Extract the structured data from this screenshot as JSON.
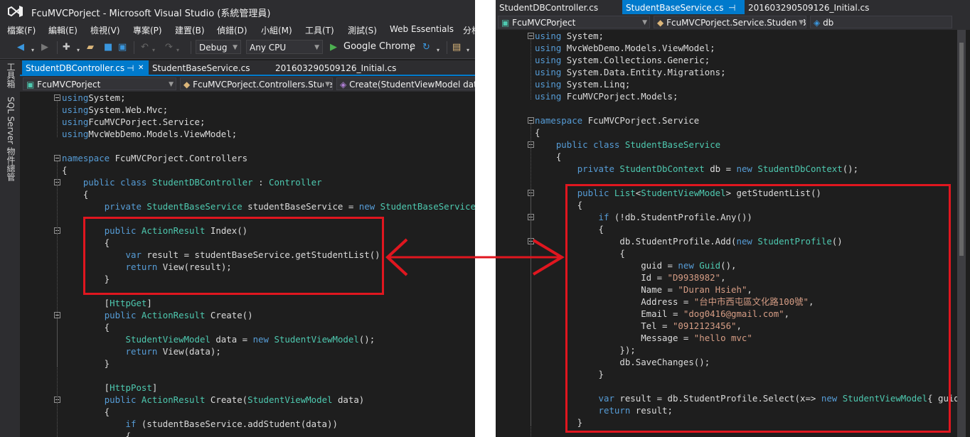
{
  "left_window": {
    "title": "FcuMVCPorject - Microsoft Visual Studio (系統管理員)",
    "menu": [
      "檔案(F)",
      "編輯(E)",
      "檢視(V)",
      "專案(P)",
      "建置(B)",
      "偵錯(D)",
      "小組(M)",
      "工具(T)",
      "測試(S)",
      "Web Essentials",
      "分析"
    ],
    "toolbar": {
      "config": "Debug",
      "platform": "Any CPU",
      "run_target": "Google Chrome"
    },
    "side_panels": [
      "工具箱",
      "SQL Server 物件總管"
    ],
    "tabs": [
      "StudentDBController.cs",
      "StudentBaseService.cs",
      "201603290509126_Initial.cs"
    ],
    "pin_glyph": "⊣",
    "close_glyph": "✕",
    "nav": {
      "project": "FcuMVCPorject",
      "class": "FcuMVCPorject.Controllers.Stude",
      "member": "Create(StudentViewModel data"
    },
    "code": [
      [
        [
          "kw",
          "using"
        ],
        [
          "",
          "System;"
        ]
      ],
      [
        [
          "kw",
          "using"
        ],
        [
          "",
          "System.Web.Mvc;"
        ]
      ],
      [
        [
          "kw",
          "using"
        ],
        [
          "",
          "FcuMVCPorject.Service;"
        ]
      ],
      [
        [
          "kw",
          "using"
        ],
        [
          "",
          "MvcWebDemo.Models.ViewModel;"
        ]
      ],
      [],
      [
        [
          "kw",
          "namespace"
        ],
        [
          "",
          " FcuMVCPorject.Controllers"
        ]
      ],
      [
        [
          "",
          "{"
        ]
      ],
      [
        [
          "",
          "    "
        ],
        [
          "kw",
          "public"
        ],
        [
          "",
          " "
        ],
        [
          "kw",
          "class"
        ],
        [
          "",
          " "
        ],
        [
          "ty",
          "StudentDBController"
        ],
        [
          "",
          " : "
        ],
        [
          "ty",
          "Controller"
        ]
      ],
      [
        [
          "",
          "    {"
        ]
      ],
      [
        [
          "",
          "        "
        ],
        [
          "kw",
          "private"
        ],
        [
          "",
          " "
        ],
        [
          "ty",
          "StudentBaseService"
        ],
        [
          "",
          " studentBaseService = "
        ],
        [
          "kw",
          "new"
        ],
        [
          "",
          " "
        ],
        [
          "ty",
          "StudentBaseService"
        ],
        [
          "",
          "();"
        ]
      ],
      [],
      [
        [
          "",
          "        "
        ],
        [
          "kw",
          "public"
        ],
        [
          "",
          " "
        ],
        [
          "ty",
          "ActionResult"
        ],
        [
          "",
          " Index()"
        ]
      ],
      [
        [
          "",
          "        {"
        ]
      ],
      [
        [
          "",
          "            "
        ],
        [
          "kw",
          "var"
        ],
        [
          "",
          " result = studentBaseService.getStudentList();"
        ]
      ],
      [
        [
          "",
          "            "
        ],
        [
          "kw",
          "return"
        ],
        [
          "",
          " View(result);"
        ]
      ],
      [
        [
          "",
          "        }"
        ]
      ],
      [],
      [
        [
          "",
          "        ["
        ],
        [
          "ty",
          "HttpGet"
        ],
        [
          "",
          "]"
        ]
      ],
      [
        [
          "",
          "        "
        ],
        [
          "kw",
          "public"
        ],
        [
          "",
          " "
        ],
        [
          "ty",
          "ActionResult"
        ],
        [
          "",
          " Create()"
        ]
      ],
      [
        [
          "",
          "        {"
        ]
      ],
      [
        [
          "",
          "            "
        ],
        [
          "ty",
          "StudentViewModel"
        ],
        [
          "",
          " data = "
        ],
        [
          "kw",
          "new"
        ],
        [
          "",
          " "
        ],
        [
          "ty",
          "StudentViewModel"
        ],
        [
          "",
          "();"
        ]
      ],
      [
        [
          "",
          "            "
        ],
        [
          "kw",
          "return"
        ],
        [
          "",
          " View(data);"
        ]
      ],
      [
        [
          "",
          "        }"
        ]
      ],
      [],
      [
        [
          "",
          "        ["
        ],
        [
          "ty",
          "HttpPost"
        ],
        [
          "",
          "]"
        ]
      ],
      [
        [
          "",
          "        "
        ],
        [
          "kw",
          "public"
        ],
        [
          "",
          " "
        ],
        [
          "ty",
          "ActionResult"
        ],
        [
          "",
          " Create("
        ],
        [
          "ty",
          "StudentViewModel"
        ],
        [
          "",
          " data)"
        ]
      ],
      [
        [
          "",
          "        {"
        ]
      ],
      [
        [
          "",
          "            "
        ],
        [
          "kw",
          "if"
        ],
        [
          "",
          " (studentBaseService.addStudent(data))"
        ]
      ],
      [
        [
          "",
          "            {"
        ]
      ]
    ]
  },
  "right_window": {
    "tabs": [
      "StudentDBController.cs",
      "StudentBaseService.cs",
      "201603290509126_Initial.cs"
    ],
    "pin_glyph": "⊣",
    "nav": {
      "project": "FcuMVCPorject",
      "class": "FcuMVCPorject.Service.StudentB",
      "member": "db"
    },
    "code": [
      [
        [
          "kw",
          "using"
        ],
        [
          "",
          " System;"
        ]
      ],
      [
        [
          "kw",
          "using"
        ],
        [
          "",
          " MvcWebDemo.Models.ViewModel;"
        ]
      ],
      [
        [
          "kw",
          "using"
        ],
        [
          "",
          " System.Collections.Generic;"
        ]
      ],
      [
        [
          "kw",
          "using"
        ],
        [
          "",
          " System.Data.Entity.Migrations;"
        ]
      ],
      [
        [
          "kw",
          "using"
        ],
        [
          "",
          " System.Linq;"
        ]
      ],
      [
        [
          "kw",
          "using"
        ],
        [
          "",
          " FcuMVCPorject.Models;"
        ]
      ],
      [],
      [
        [
          "kw",
          "namespace"
        ],
        [
          "",
          " FcuMVCPorject.Service"
        ]
      ],
      [
        [
          "",
          "{"
        ]
      ],
      [
        [
          "",
          "    "
        ],
        [
          "kw",
          "public"
        ],
        [
          "",
          " "
        ],
        [
          "kw",
          "class"
        ],
        [
          "",
          " "
        ],
        [
          "ty",
          "StudentBaseService"
        ]
      ],
      [
        [
          "",
          "    {"
        ]
      ],
      [
        [
          "",
          "        "
        ],
        [
          "kw",
          "private"
        ],
        [
          "",
          " "
        ],
        [
          "ty",
          "StudentDbContext"
        ],
        [
          "",
          " db = "
        ],
        [
          "kw",
          "new"
        ],
        [
          "",
          " "
        ],
        [
          "ty",
          "StudentDbContext"
        ],
        [
          "",
          "();"
        ]
      ],
      [],
      [
        [
          "",
          "        "
        ],
        [
          "kw",
          "public"
        ],
        [
          "",
          " "
        ],
        [
          "ty",
          "List"
        ],
        [
          "",
          "<"
        ],
        [
          "ty",
          "StudentViewModel"
        ],
        [
          "",
          "> getStudentList()"
        ]
      ],
      [
        [
          "",
          "        {"
        ]
      ],
      [
        [
          "",
          "            "
        ],
        [
          "kw",
          "if"
        ],
        [
          "",
          " (!db.StudentProfile.Any())"
        ]
      ],
      [
        [
          "",
          "            {"
        ]
      ],
      [
        [
          "",
          "                db.StudentProfile.Add("
        ],
        [
          "kw",
          "new"
        ],
        [
          "",
          " "
        ],
        [
          "ty",
          "StudentProfile"
        ],
        [
          "",
          "()"
        ]
      ],
      [
        [
          "",
          "                {"
        ]
      ],
      [
        [
          "",
          "                    guid = "
        ],
        [
          "kw",
          "new"
        ],
        [
          "",
          " "
        ],
        [
          "ty",
          "Guid"
        ],
        [
          "",
          "(),"
        ]
      ],
      [
        [
          "",
          "                    Id = "
        ],
        [
          "st",
          "\"D9938982\""
        ],
        [
          "",
          ","
        ]
      ],
      [
        [
          "",
          "                    Name = "
        ],
        [
          "st",
          "\"Duran Hsieh\""
        ],
        [
          "",
          ","
        ]
      ],
      [
        [
          "",
          "                    Address = "
        ],
        [
          "st",
          "\"台中市西屯區文化路100號\""
        ],
        [
          "",
          ","
        ]
      ],
      [
        [
          "",
          "                    Email = "
        ],
        [
          "st",
          "\"dog0416@gmail.com\""
        ],
        [
          "",
          ","
        ]
      ],
      [
        [
          "",
          "                    Tel = "
        ],
        [
          "st",
          "\"0912123456\""
        ],
        [
          "",
          ","
        ]
      ],
      [
        [
          "",
          "                    Message = "
        ],
        [
          "st",
          "\"hello mvc\""
        ]
      ],
      [
        [
          "",
          "                });"
        ]
      ],
      [
        [
          "",
          "                db.SaveChanges();"
        ]
      ],
      [
        [
          "",
          "            }"
        ]
      ],
      [],
      [
        [
          "",
          "            "
        ],
        [
          "kw",
          "var"
        ],
        [
          "",
          " result = db.StudentProfile.Select(x=> "
        ],
        [
          "kw",
          "new"
        ],
        [
          "",
          " "
        ],
        [
          "ty",
          "StudentViewModel"
        ],
        [
          "",
          "{ guid ="
        ]
      ],
      [
        [
          "",
          "            "
        ],
        [
          "kw",
          "return"
        ],
        [
          "",
          " result;"
        ]
      ],
      [
        [
          "",
          "        }"
        ]
      ]
    ]
  },
  "colors": {
    "accent": "#007acc",
    "highlight": "#e0161f",
    "keyword": "#569cd6",
    "type": "#4ec9b0",
    "string": "#d69d85",
    "editor_bg": "#1e1e1e"
  }
}
